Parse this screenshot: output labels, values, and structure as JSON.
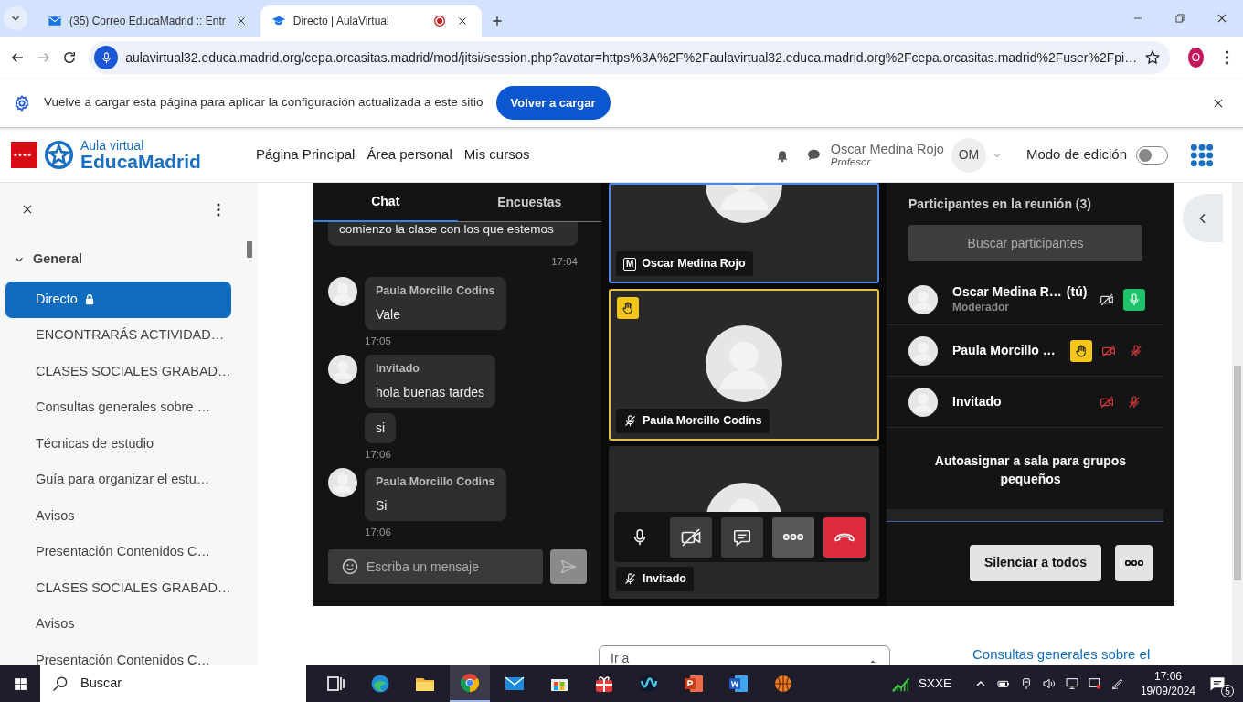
{
  "browser": {
    "tabs": [
      {
        "title": "(35) Correo EducaMadrid :: Entr",
        "kind": "mail",
        "selected": false,
        "recording": false
      },
      {
        "title": "Directo | AulaVirtual",
        "kind": "course",
        "selected": true,
        "recording": true
      }
    ],
    "address": "aulavirtual32.educa.madrid.org/cepa.orcasitas.madrid/mod/jitsi/session.php?avatar=https%3A%2F%2Faulavirtual32.educa.madrid.org%2Fcepa.orcasitas.madrid%2Fuser%2Fpi…",
    "profile_initial": "O"
  },
  "infobar": {
    "message": "Vuelve a cargar esta página para aplicar la configuración actualizada a este sitio",
    "button": "Volver a cargar"
  },
  "site": {
    "logo_top": "Aula virtual",
    "logo_bottom": "EducaMadrid",
    "nav": [
      "Página Principal",
      "Área personal",
      "Mis cursos"
    ],
    "user_name": "Oscar Medina Rojo",
    "user_role": "Profesor",
    "initials": "OM",
    "edit_mode_label": "Modo de edición",
    "edit_mode": false
  },
  "sidebar": {
    "section": "General",
    "expanded": true,
    "items": [
      {
        "label": "Directo",
        "selected": true,
        "locked": true
      },
      {
        "label": "ENCONTRARÁS ACTIVIDAD…",
        "selected": false,
        "locked": false
      },
      {
        "label": "CLASES SOCIALES GRABAD…",
        "selected": false,
        "locked": false
      },
      {
        "label": "Consultas generales sobre …",
        "selected": false,
        "locked": false
      },
      {
        "label": "Técnicas de estudio",
        "selected": false,
        "locked": false
      },
      {
        "label": "Guía para organizar el estu…",
        "selected": false,
        "locked": false
      },
      {
        "label": "Avisos",
        "selected": false,
        "locked": false
      },
      {
        "label": "Presentación Contenidos C…",
        "selected": false,
        "locked": false
      },
      {
        "label": "CLASES SOCIALES GRABAD…",
        "selected": false,
        "locked": false
      },
      {
        "label": "Avisos",
        "selected": false,
        "locked": false
      },
      {
        "label": "Presentación Contenidos C…",
        "selected": false,
        "locked": false
      }
    ]
  },
  "chat": {
    "tabs": [
      {
        "label": "Chat",
        "selected": true
      },
      {
        "label": "Encuestas",
        "selected": false
      }
    ],
    "messages": [
      {
        "kind": "own",
        "texts": [
          "comienzo la clase con los que estemos"
        ],
        "time": "17:04"
      },
      {
        "kind": "other",
        "sender": "Paula Morcillo Codins",
        "texts": [
          "Vale"
        ],
        "time": "17:05"
      },
      {
        "kind": "other",
        "sender": "Invitado",
        "texts": [
          "hola buenas tardes",
          "si"
        ],
        "time": "17:06"
      },
      {
        "kind": "other",
        "sender": "Paula Morcillo Codins",
        "texts": [
          "Si"
        ],
        "time": "17:06"
      }
    ],
    "placeholder": "Escriba un mensaje"
  },
  "videos": [
    {
      "name": "Oscar Medina Rojo",
      "moderator_badge": "M",
      "audio_muted": false,
      "hand_raised": false,
      "dominant": true
    },
    {
      "name": "Paula Morcillo Codins",
      "audio_muted": true,
      "hand_raised": true,
      "dominant": false
    },
    {
      "name": "Invitado",
      "audio_muted": true,
      "hand_raised": false,
      "dominant": false
    }
  ],
  "participants": {
    "title": "Participantes en la reunión (3)",
    "search_placeholder": "Buscar participantes",
    "list": [
      {
        "name": "Oscar Medina R…",
        "suffix": "(tú)",
        "role": "Moderador",
        "hand_raised": false,
        "video_muted": true,
        "audio_muted": false
      },
      {
        "name": "Paula Morcillo …",
        "hand_raised": true,
        "video_muted": true,
        "audio_muted": true
      },
      {
        "name": "Invitado",
        "hand_raised": false,
        "video_muted": true,
        "audio_muted": true
      }
    ],
    "breakout": "Autoasignar a sala para grupos pequeños",
    "mute_all": "Silenciar a todos"
  },
  "below": {
    "jump_select": "Ir a",
    "link": "Consultas generales sobre el"
  },
  "taskbar": {
    "search_placeholder": "Buscar",
    "apps": [
      {
        "kind": "taskview",
        "selected": false
      },
      {
        "kind": "swirl",
        "selected": false
      },
      {
        "kind": "folder",
        "selected": false
      },
      {
        "kind": "ball-browser",
        "selected": true
      },
      {
        "kind": "envelope",
        "selected": false
      },
      {
        "kind": "bag",
        "selected": false
      },
      {
        "kind": "gift",
        "selected": false
      },
      {
        "kind": "wave",
        "selected": false
      },
      {
        "kind": "slides",
        "selected": false
      },
      {
        "kind": "doc",
        "selected": false
      },
      {
        "kind": "ball",
        "selected": false
      }
    ],
    "ticker": "SXXE",
    "time": "17:06",
    "date": "19/09/2024",
    "notifications": "5"
  }
}
